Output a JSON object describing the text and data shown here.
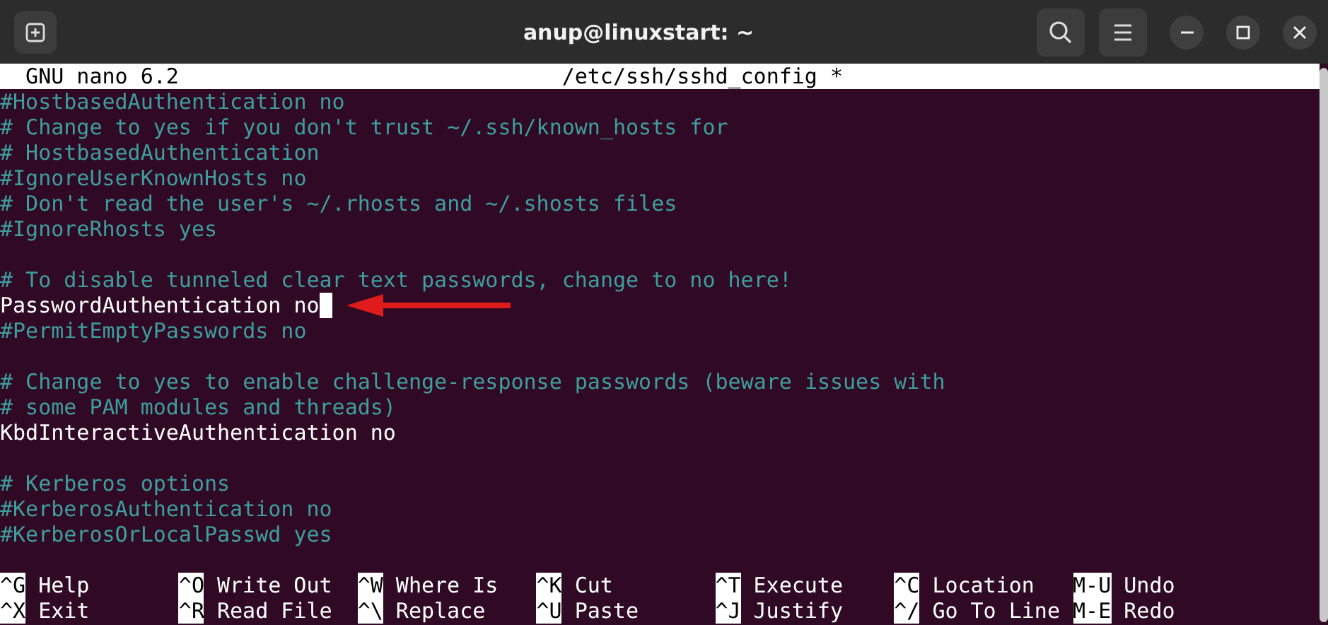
{
  "window": {
    "title": "anup@linuxstart: ~"
  },
  "nano_header": {
    "version": "GNU nano 6.2",
    "file": "/etc/ssh/sshd_config *"
  },
  "lines": [
    {
      "kind": "comment",
      "text": "#HostbasedAuthentication no"
    },
    {
      "kind": "comment",
      "text": "# Change to yes if you don't trust ~/.ssh/known_hosts for"
    },
    {
      "kind": "comment",
      "text": "# HostbasedAuthentication"
    },
    {
      "kind": "comment",
      "text": "#IgnoreUserKnownHosts no"
    },
    {
      "kind": "comment",
      "text": "# Don't read the user's ~/.rhosts and ~/.shosts files"
    },
    {
      "kind": "comment",
      "text": "#IgnoreRhosts yes"
    },
    {
      "kind": "blank"
    },
    {
      "kind": "comment",
      "text": "# To disable tunneled clear text passwords, change to no here!"
    },
    {
      "kind": "code",
      "text": "PasswordAuthentication no",
      "cursor": true
    },
    {
      "kind": "comment",
      "text": "#PermitEmptyPasswords no"
    },
    {
      "kind": "blank"
    },
    {
      "kind": "comment",
      "text": "# Change to yes to enable challenge-response passwords (beware issues with"
    },
    {
      "kind": "comment",
      "text": "# some PAM modules and threads)"
    },
    {
      "kind": "code",
      "text": "KbdInteractiveAuthentication no",
      "cursor": false
    },
    {
      "kind": "blank"
    },
    {
      "kind": "comment",
      "text": "# Kerberos options"
    },
    {
      "kind": "comment",
      "text": "#KerberosAuthentication no"
    },
    {
      "kind": "comment",
      "text": "#KerberosOrLocalPasswd yes"
    }
  ],
  "shortcuts": [
    [
      {
        "key": "^G",
        "label": "Help"
      },
      {
        "key": "^O",
        "label": "Write Out"
      },
      {
        "key": "^W",
        "label": "Where Is"
      },
      {
        "key": "^K",
        "label": "Cut"
      },
      {
        "key": "^T",
        "label": "Execute"
      },
      {
        "key": "^C",
        "label": "Location"
      },
      {
        "key": "M-U",
        "label": "Undo"
      }
    ],
    [
      {
        "key": "^X",
        "label": "Exit"
      },
      {
        "key": "^R",
        "label": "Read File"
      },
      {
        "key": "^\\",
        "label": "Replace"
      },
      {
        "key": "^U",
        "label": "Paste"
      },
      {
        "key": "^J",
        "label": "Justify"
      },
      {
        "key": "^/",
        "label": "Go To Line"
      },
      {
        "key": "M-E",
        "label": "Redo"
      }
    ]
  ]
}
